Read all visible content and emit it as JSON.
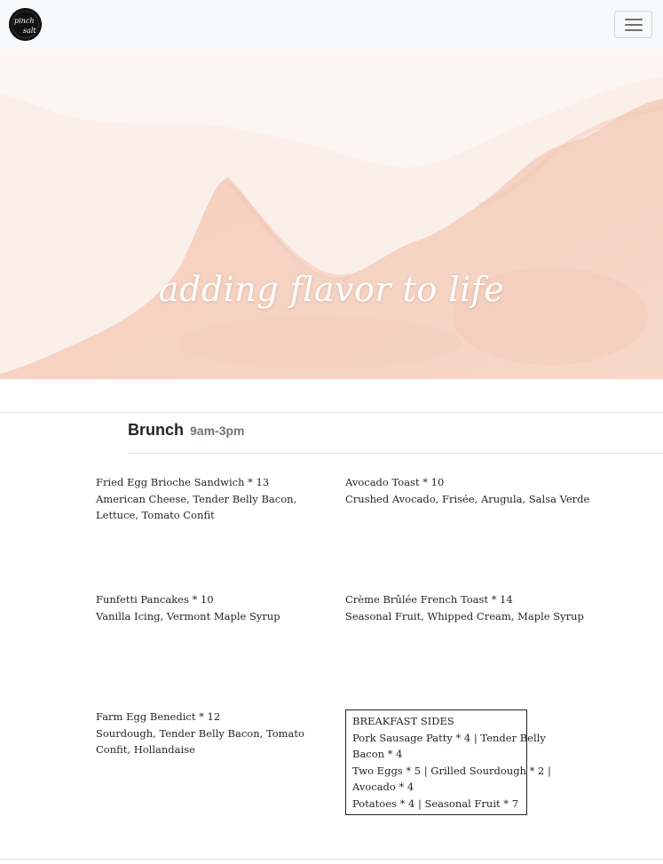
{
  "navbar": {
    "logo": {
      "icon": "pinch-salt-logo-icon",
      "text_line1": "pinch",
      "text_line2": "salt"
    },
    "menu_toggle": {
      "icon": "hamburger-menu-icon"
    }
  },
  "hero": {
    "tagline": "adding flavor to life",
    "colors": {
      "base": "#f7dcd0",
      "foam": "#fbf1ec",
      "shadow": "#efc2ae"
    }
  },
  "menu": {
    "section": {
      "title": "Brunch",
      "hours": "9am-3pm"
    },
    "items": [
      {
        "name": "Fried Egg Brioche Sandwich * 13",
        "description": "American Cheese, Tender Belly Bacon, Lettuce, Tomato Confit"
      },
      {
        "name": "Avocado Toast * 10",
        "description": "Crushed Avocado, Frisée, Arugula, Salsa Verde"
      },
      {
        "name": "Funfetti Pancakes * 10",
        "description": "Vanilla Icing, Vermont Maple Syrup"
      },
      {
        "name": "Crème Brûlée French Toast * 14",
        "description": "Seasonal Fruit, Whipped Cream, Maple Syrup"
      },
      {
        "name": "Farm Egg Benedict * 12",
        "description": "Sourdough, Tender Belly Bacon, Tomato Confit, Hollandaise"
      }
    ],
    "sides": {
      "title": "BREAKFAST SIDES",
      "lines": [
        "Pork Sausage Patty * 4 | Tender Belly",
        "Bacon * 4",
        "Two Eggs * 5 | Grilled Sourdough * 2 |",
        "Avocado * 4",
        "Potatoes * 4 | Seasonal Fruit * 7"
      ]
    }
  }
}
